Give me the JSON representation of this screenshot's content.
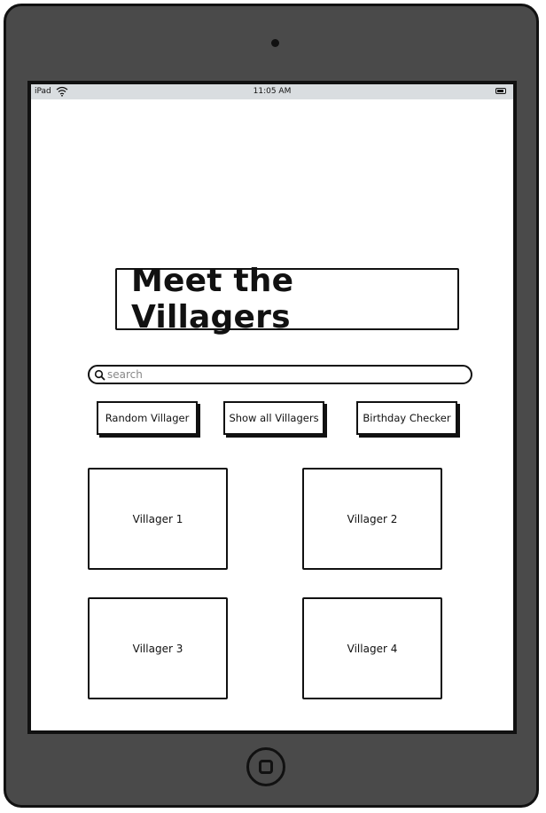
{
  "status_bar": {
    "device": "iPad",
    "time": "11:05 AM"
  },
  "page": {
    "title": "Meet the Villagers"
  },
  "search": {
    "placeholder": "search",
    "value": ""
  },
  "buttons": {
    "random": "Random Villager",
    "show_all": "Show all Villagers",
    "birthday": "Birthday Checker"
  },
  "villagers": [
    {
      "label": "Villager 1"
    },
    {
      "label": "Villager 2"
    },
    {
      "label": "Villager 3"
    },
    {
      "label": "Villager 4"
    }
  ],
  "icons": {
    "wifi": "wifi-icon",
    "battery": "battery-icon",
    "search": "search-icon",
    "home": "home-button-icon",
    "camera": "camera-icon"
  },
  "colors": {
    "device_body": "#4a4a4a",
    "status_bar": "#d9dde0",
    "outline": "#111111"
  }
}
